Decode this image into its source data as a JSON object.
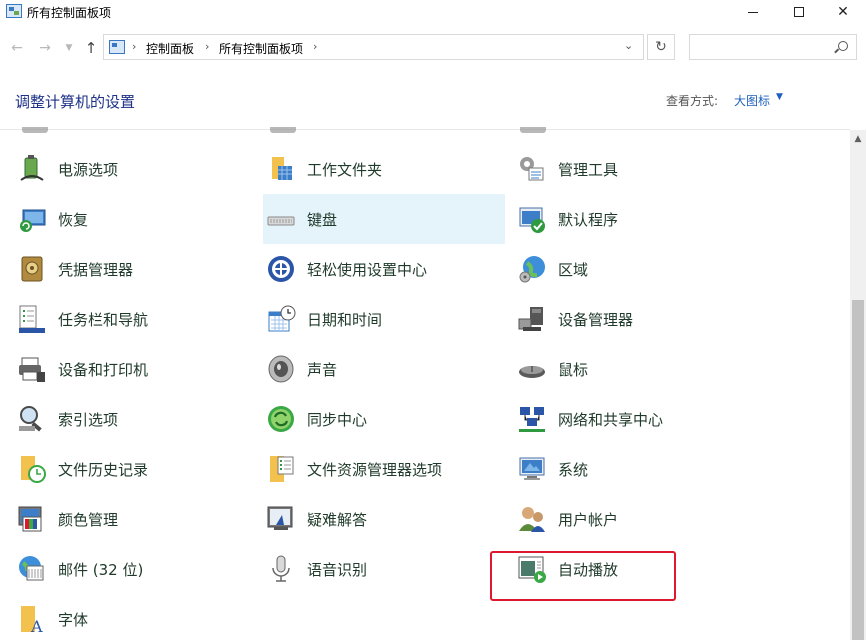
{
  "window": {
    "title": "所有控制面板项"
  },
  "address": {
    "crumbs": [
      "控制面板",
      "所有控制面板项"
    ],
    "search_placeholder": ""
  },
  "header": {
    "title": "调整计算机的设置",
    "view_label": "查看方式:",
    "view_value": "大图标"
  },
  "items": [
    {
      "label": "电源选项",
      "icon": "power-options-icon"
    },
    {
      "label": "工作文件夹",
      "icon": "work-folders-icon"
    },
    {
      "label": "管理工具",
      "icon": "admin-tools-icon"
    },
    {
      "label": "恢复",
      "icon": "recovery-icon"
    },
    {
      "label": "键盘",
      "icon": "keyboard-icon",
      "selected": true
    },
    {
      "label": "默认程序",
      "icon": "default-programs-icon"
    },
    {
      "label": "凭据管理器",
      "icon": "credential-manager-icon"
    },
    {
      "label": "轻松使用设置中心",
      "icon": "ease-of-access-icon"
    },
    {
      "label": "区域",
      "icon": "region-icon"
    },
    {
      "label": "任务栏和导航",
      "icon": "taskbar-icon"
    },
    {
      "label": "日期和时间",
      "icon": "date-time-icon"
    },
    {
      "label": "设备管理器",
      "icon": "device-manager-icon"
    },
    {
      "label": "设备和打印机",
      "icon": "devices-printers-icon"
    },
    {
      "label": "声音",
      "icon": "sound-icon"
    },
    {
      "label": "鼠标",
      "icon": "mouse-icon"
    },
    {
      "label": "索引选项",
      "icon": "indexing-icon"
    },
    {
      "label": "同步中心",
      "icon": "sync-center-icon"
    },
    {
      "label": "网络和共享中心",
      "icon": "network-sharing-icon"
    },
    {
      "label": "文件历史记录",
      "icon": "file-history-icon"
    },
    {
      "label": "文件资源管理器选项",
      "icon": "explorer-options-icon"
    },
    {
      "label": "系统",
      "icon": "system-icon"
    },
    {
      "label": "颜色管理",
      "icon": "color-management-icon"
    },
    {
      "label": "疑难解答",
      "icon": "troubleshooting-icon"
    },
    {
      "label": "用户帐户",
      "icon": "user-accounts-icon"
    },
    {
      "label": "邮件 (32 位)",
      "icon": "mail-icon"
    },
    {
      "label": "语音识别",
      "icon": "speech-recognition-icon"
    },
    {
      "label": "自动播放",
      "icon": "autoplay-icon"
    },
    {
      "label": "字体",
      "icon": "fonts-icon"
    }
  ],
  "colors": {
    "selected_bg": "#e5f3fb",
    "highlight_border": "#e0182f",
    "title_text": "#1e3287",
    "link": "#1f5fbf"
  }
}
